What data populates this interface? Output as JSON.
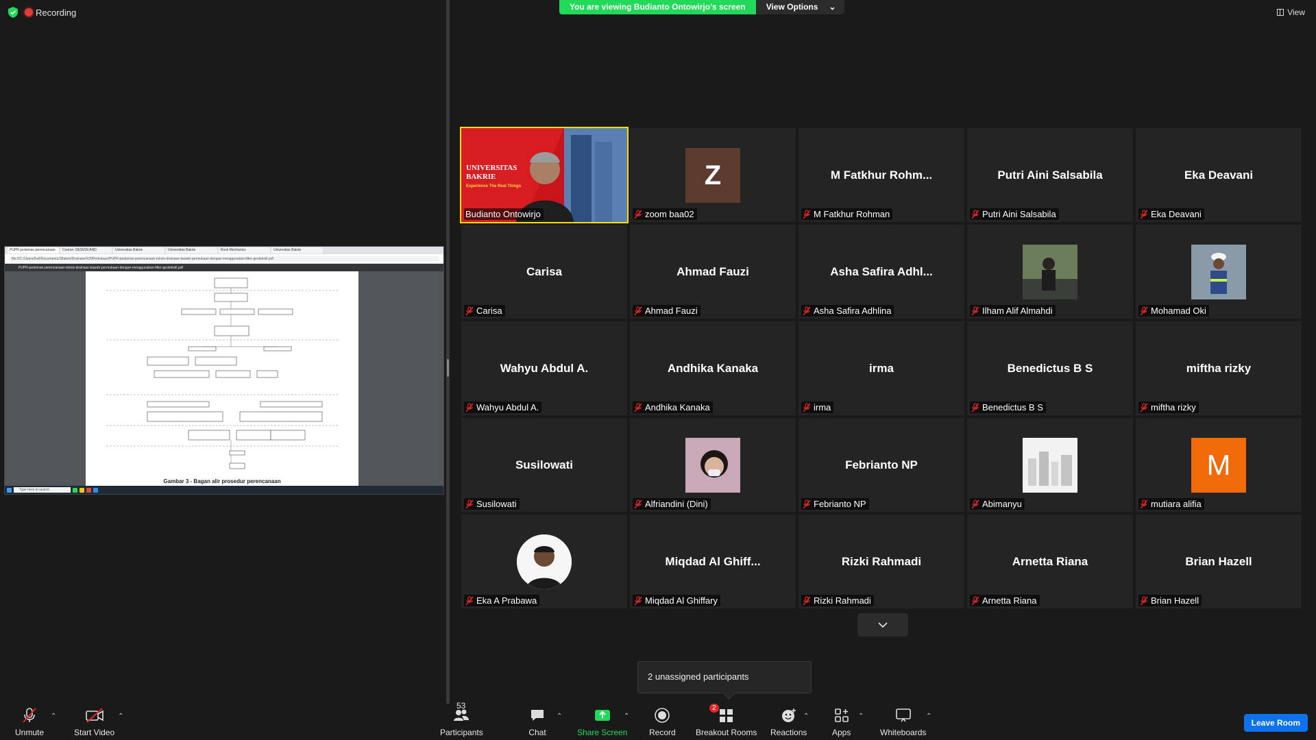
{
  "recording": {
    "label": "Recording"
  },
  "banner": {
    "viewing_text": "You are viewing Budianto Ontowirjo's screen",
    "view_options": "View Options"
  },
  "view_button": "View",
  "shared_screen": {
    "tabs": [
      "PUPR pedoman perencanaan",
      "Course: DESIGN AND",
      "Universitas Bakrie",
      "Universitas Bakrie",
      "Rock Mechanics",
      "Universitas Bakrie"
    ],
    "url": "file:///C:/Users/Dell/Documents/1Bakrie/Drainase%20Perkotaan/PUPR-pedoman-perencanaan-teknis-drainase-bawah-permukaan-dengan-menggunakan-filter-geotekstil.pdf",
    "pdf_title": "PUPR-pedoman-perencanaan-teknis-drainase-bawah-permukaan-dengan-menggunakan-filter-geotekstil.pdf",
    "caption": "Gambar 3 - Bagan alir prosedur perencanaan",
    "search_placeholder": "Type here to search"
  },
  "participants_grid": [
    {
      "display": "video",
      "tile_name": "Budianto Ontowirjo",
      "video_text": "UNIVERSITAS BAKRIE",
      "video_sub": "Experience The Real Things",
      "active": true,
      "muted": false
    },
    {
      "display": "letter",
      "letter": "Z",
      "tile_name": "zoom baa02",
      "muted": true
    },
    {
      "display": "name",
      "center": "M  Fatkhur  Rohm...",
      "tile_name": "M Fatkhur Rohman",
      "muted": true
    },
    {
      "display": "name",
      "center": "Putri Aini Salsabila",
      "tile_name": "Putri Aini Salsabila",
      "muted": true
    },
    {
      "display": "name",
      "center": "Eka Deavani",
      "tile_name": "Eka Deavani",
      "muted": true
    },
    {
      "display": "name",
      "center": "Carisa",
      "tile_name": "Carisa",
      "muted": true
    },
    {
      "display": "name",
      "center": "Ahmad Fauzi",
      "tile_name": "Ahmad Fauzi",
      "muted": true
    },
    {
      "display": "name",
      "center": "Asha  Safira  Adhl...",
      "tile_name": "Asha Safira Adhlina",
      "muted": true
    },
    {
      "display": "photo",
      "photo": "person-outdoor",
      "tile_name": "Ilham Alif Almahdi",
      "muted": true
    },
    {
      "display": "photo",
      "photo": "worker-vest",
      "tile_name": "Mohamad Oki",
      "muted": true
    },
    {
      "display": "name",
      "center": "Wahyu Abdul A.",
      "tile_name": "Wahyu Abdul A.",
      "muted": true
    },
    {
      "display": "name",
      "center": "Andhika Kanaka",
      "tile_name": "Andhika Kanaka",
      "muted": true
    },
    {
      "display": "name",
      "center": "irma",
      "tile_name": "irma",
      "muted": true
    },
    {
      "display": "name",
      "center": "Benedictus B S",
      "tile_name": "Benedictus B S",
      "muted": true
    },
    {
      "display": "name",
      "center": "miftha rizky",
      "tile_name": "miftha rizky",
      "muted": true
    },
    {
      "display": "name",
      "center": "Susilowati",
      "tile_name": "Susilowati",
      "muted": true
    },
    {
      "display": "photo",
      "photo": "woman-mask",
      "tile_name": "Alfriandini (Dini)",
      "muted": true
    },
    {
      "display": "name",
      "center": "Febrianto NP",
      "tile_name": "Febrianto NP",
      "muted": true
    },
    {
      "display": "photo",
      "photo": "city-sketch",
      "tile_name": "Abimanyu",
      "muted": true
    },
    {
      "display": "letter-orange",
      "letter": "M",
      "tile_name": "mutiara alifia",
      "muted": true
    },
    {
      "display": "photo-circle",
      "photo": "man-portrait",
      "tile_name": "Eka A Prabawa",
      "muted": true
    },
    {
      "display": "name",
      "center": "Miqdad  Al  Ghiff...",
      "tile_name": "Miqdad Al Ghiffary",
      "muted": true
    },
    {
      "display": "name",
      "center": "Rizki Rahmadi",
      "tile_name": "Rizki Rahmadi",
      "muted": true
    },
    {
      "display": "name",
      "center": "Arnetta Riana",
      "tile_name": "Arnetta Riana",
      "muted": true
    },
    {
      "display": "name",
      "center": "Brian Hazell",
      "tile_name": "Brian Hazell",
      "muted": true
    }
  ],
  "tooltip": "2 unassigned participants",
  "toolbar": {
    "unmute": "Unmute",
    "start_video": "Start Video",
    "participants": "Participants",
    "participants_count": "53",
    "chat": "Chat",
    "share_screen": "Share Screen",
    "record": "Record",
    "breakout_rooms": "Breakout Rooms",
    "breakout_badge": "2",
    "reactions": "Reactions",
    "apps": "Apps",
    "whiteboards": "Whiteboards",
    "leave": "Leave Room"
  },
  "colors": {
    "accent_green": "#23d959",
    "active_speaker": "#fede00",
    "leave_blue": "#0e72ed",
    "muted_red": "#e02828"
  }
}
